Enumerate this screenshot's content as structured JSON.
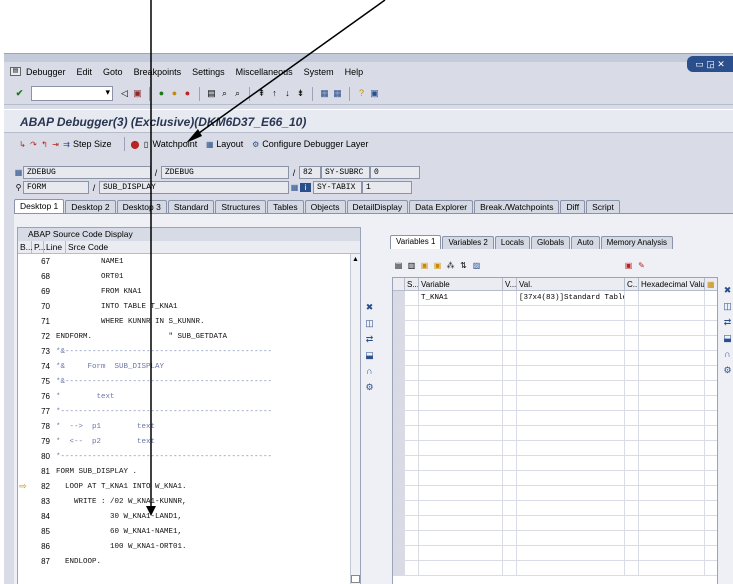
{
  "menu": [
    "Debugger",
    "Edit",
    "Goto",
    "Breakpoints",
    "Settings",
    "Miscellaneous",
    "System",
    "Help"
  ],
  "window_title": "ABAP Debugger(3)  (Exclusive)(DKM6D37_E66_10)",
  "app_toolbar": {
    "step_size": "Step Size",
    "watchpoint": "Watchpoint",
    "layout": "Layout",
    "configure": "Configure Debugger Layer"
  },
  "fields": {
    "program1": "ZDEBUG",
    "program2": "ZDEBUG",
    "line": "82",
    "sy_subrc_label": "SY-SUBRC",
    "sy_subrc": "0",
    "event_type": "FORM",
    "event_name": "SUB_DISPLAY",
    "sy_tabix_label": "SY-TABIX",
    "sy_tabix": "1"
  },
  "tabs": [
    "Desktop 1",
    "Desktop 2",
    "Desktop 3",
    "Standard",
    "Structures",
    "Tables",
    "Objects",
    "DetailDisplay",
    "Data Explorer",
    "Break./Watchpoints",
    "Diff",
    "Script"
  ],
  "source": {
    "title": "ABAP Source Code Display",
    "headers": [
      "B...",
      "P...",
      "Line",
      "Srce Code"
    ],
    "rows": [
      {
        "line": "67",
        "code": "          NAME1",
        "bp": ""
      },
      {
        "line": "68",
        "code": "          ORT01",
        "bp": ""
      },
      {
        "line": "69",
        "code": "          FROM KNA1",
        "bp": ""
      },
      {
        "line": "70",
        "code": "          INTO TABLE T_KNA1",
        "bp": ""
      },
      {
        "line": "71",
        "code": "          WHERE KUNNR IN S_KUNNR.",
        "bp": ""
      },
      {
        "line": "72",
        "code": "ENDFORM.                 \" SUB_GETDATA",
        "bp": ""
      },
      {
        "line": "73",
        "code": "*&----------------------------------------------",
        "bp": ""
      },
      {
        "line": "74",
        "code": "*&     Form  SUB_DISPLAY",
        "bp": ""
      },
      {
        "line": "75",
        "code": "*&----------------------------------------------",
        "bp": ""
      },
      {
        "line": "76",
        "code": "*        text",
        "bp": ""
      },
      {
        "line": "77",
        "code": "*-----------------------------------------------",
        "bp": ""
      },
      {
        "line": "78",
        "code": "*  -->  p1        text",
        "bp": ""
      },
      {
        "line": "79",
        "code": "*  <--  p2        text",
        "bp": ""
      },
      {
        "line": "80",
        "code": "*-----------------------------------------------",
        "bp": ""
      },
      {
        "line": "81",
        "code": "FORM SUB_DISPLAY .",
        "bp": ""
      },
      {
        "line": "82",
        "code": "  LOOP AT T_KNA1 INTO W_KNA1.",
        "bp": "⇨"
      },
      {
        "line": "83",
        "code": "    WRITE : /02 W_KNA1-KUNNR,",
        "bp": ""
      },
      {
        "line": "84",
        "code": "            30 W_KNA1-LAND1,",
        "bp": ""
      },
      {
        "line": "85",
        "code": "            60 W_KNA1-NAME1,",
        "bp": ""
      },
      {
        "line": "86",
        "code": "            100 W_KNA1-ORT01.",
        "bp": ""
      },
      {
        "line": "87",
        "code": "  ENDLOOP.",
        "bp": ""
      }
    ]
  },
  "var_tabs": [
    "Variables 1",
    "Variables 2",
    "Locals",
    "Globals",
    "Auto",
    "Memory Analysis"
  ],
  "var_table": {
    "headers": [
      "S...",
      "Variable",
      "V...",
      "Val.",
      "C...",
      "Hexadecimal Value"
    ],
    "rows": [
      {
        "variable": "T_KNA1",
        "value": "[37x4(83)]Standard Table"
      }
    ]
  },
  "colors": {
    "accent": "#2a4f8c",
    "bg": "#d9dce6"
  }
}
